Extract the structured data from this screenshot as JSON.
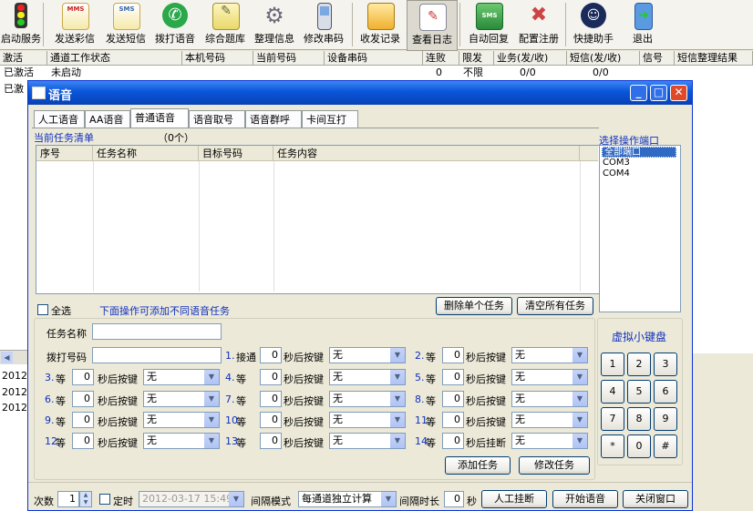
{
  "toolbar": {
    "items": [
      {
        "label": "启动服务",
        "icon": "traffic-light-icon"
      },
      {
        "label": "发送彩信",
        "icon": "mms-envelope-icon"
      },
      {
        "label": "发送短信",
        "icon": "sms-envelope-icon"
      },
      {
        "label": "拨打语音",
        "icon": "phone-icon"
      },
      {
        "label": "综合题库",
        "icon": "notepad-icon"
      },
      {
        "label": "整理信息",
        "icon": "gears-icon"
      },
      {
        "label": "修改串码",
        "icon": "mobile-phone-icon"
      },
      {
        "label": "收发记录",
        "icon": "inbox-tray-icon"
      },
      {
        "label": "查看日志",
        "icon": "log-pencil-icon"
      },
      {
        "label": "自动回复",
        "icon": "auto-reply-icon"
      },
      {
        "label": "配置注册",
        "icon": "tools-icon"
      },
      {
        "label": "快捷助手",
        "icon": "assistant-icon"
      },
      {
        "label": "退出",
        "icon": "exit-door-icon"
      }
    ]
  },
  "grid": {
    "headers": [
      "激活",
      "通道工作状态",
      "本机号码",
      "当前号码",
      "设备串码",
      "连败",
      "限发",
      "业务(发/收)",
      "短信(发/收)",
      "信号",
      "短信整理结果"
    ],
    "row1": {
      "active": "已激活",
      "status": "未启动",
      "fails": "0",
      "limit": "不限",
      "biz": "0/0",
      "sms": "0/0"
    },
    "row2_active": "已激"
  },
  "background_dates": [
    "2012-",
    "2012-",
    "2012-"
  ],
  "dialog": {
    "title": "语音",
    "tabs": [
      "人工语音",
      "AA语音",
      "普通语音",
      "语音取号",
      "语音群呼",
      "卡间互打"
    ],
    "active_tab": "普通语音",
    "task_list_label": "当前任务清单",
    "task_count": "（0个）",
    "task_columns": [
      "序号",
      "任务名称",
      "目标号码",
      "任务内容"
    ],
    "port_label": "选择操作端口",
    "ports": [
      "全部端口",
      "COM3",
      "COM4"
    ],
    "select_all": "全选",
    "hint": "下面操作可添加不同语音任务",
    "delete_one": "删除单个任务",
    "clear_all": "清空所有任务",
    "task_name_label": "任务名称",
    "dial_number_label": "拨打号码",
    "connect_label": "接通",
    "wait_label": "等",
    "after_key": "秒后按键",
    "after_hangup": "秒后挂断",
    "none_option": "无",
    "step_nums": [
      "1.",
      "2.",
      "3.",
      "4.",
      "5.",
      "6.",
      "7.",
      "8.",
      "9.",
      "10.",
      "11.",
      "12.",
      "13.",
      "14."
    ],
    "zero": "0",
    "add_task": "添加任务",
    "modify_task": "修改任务",
    "keypad_title": "虚拟小键盘",
    "keypad_keys": [
      "1",
      "2",
      "3",
      "4",
      "5",
      "6",
      "7",
      "8",
      "9",
      "*",
      "0",
      "#"
    ],
    "times_label": "次数",
    "times_value": "1",
    "timer_label": "定时",
    "timer_value": "2012-03-17 15:49",
    "interval_mode_label": "间隔模式",
    "interval_mode_value": "每通道独立计算",
    "interval_time_label": "间隔时长",
    "interval_time_value": "0",
    "seconds_unit": "秒",
    "manual_hangup": "人工挂断",
    "start_voice": "开始语音",
    "close_window": "关闭窗口"
  },
  "colors": {
    "title_bar": "#0a55d8",
    "accent_blue": "#1030c0",
    "close_red": "#e04a2a"
  }
}
